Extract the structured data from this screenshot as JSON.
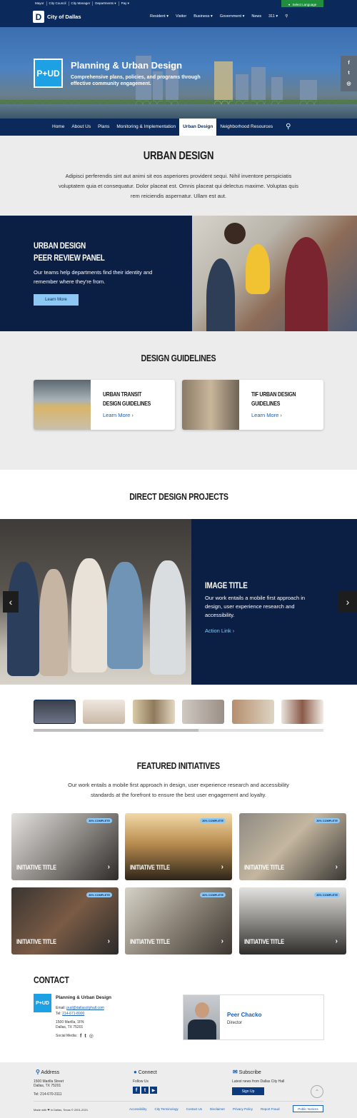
{
  "topbar": {
    "links": [
      "Mayor",
      "City Council",
      "City Manager",
      "Departments ▾",
      "Pay ▾"
    ],
    "select_language": "Select Language"
  },
  "header": {
    "logo_letter": "D",
    "logo_text": "City of Dallas",
    "nav": [
      "Resident ▾",
      "Visitor",
      "Business ▾",
      "Government ▾",
      "News",
      "311 ▾"
    ]
  },
  "hero": {
    "logo_text": "P+UD",
    "title": "Planning & Urban Design",
    "subtitle": "Comprehensive plans, policies, and programs through effective community engagement.",
    "social": [
      "f",
      "t",
      "◎"
    ]
  },
  "subnav": {
    "items": [
      "Home",
      "About Us",
      "Plans",
      "Monitoring & Implementation",
      "Urban Design",
      "Neighborhood Resources"
    ],
    "active_index": 4
  },
  "intro": {
    "title": "URBAN DESIGN",
    "text": "Adipisci perferendis sint aut animi sit eos asperiores provident sequi. Nihil inventore perspiciatis voluptatem quia et consequatur. Dolor placeat est. Omnis placeat qui delectus maxime. Voluptas quis rem reiciendis aspernatur. Ullam est aut."
  },
  "peer_review": {
    "title_line1": "URBAN DESIGN",
    "title_line2": "PEER REVIEW PANEL",
    "text": "Our teams help departments find their identity and remember where they're from.",
    "button": "Learn More"
  },
  "guidelines": {
    "title": "DESIGN GUIDELINES",
    "cards": [
      {
        "line1": "URBAN TRANSIT",
        "line2": "DESIGN GUIDELINES",
        "link": "Learn More  ›"
      },
      {
        "line1": "TIF URBAN DESIGN",
        "line2": "GUIDELINES",
        "link": "Learn More  ›"
      }
    ]
  },
  "projects": {
    "title": "DIRECT DESIGN PROJECTS",
    "slide_title": "IMAGE TITLE",
    "slide_text": "Our work entails a mobile first approach in design, user experience research and accessibility.",
    "action": "Action Link  ›",
    "prev": "‹",
    "next": "›",
    "scroll_progress": 0.57
  },
  "featured": {
    "title": "FEATURED INITIATIVES",
    "text": "Our work entails a mobile first approach in design, user experience research and accessibility standards at the forefront to ensure the best user engagement and loyalty.",
    "badge": "30% COMPLETE",
    "item_title": "INITIATIVE TITLE",
    "chevron": "›"
  },
  "contact": {
    "title": "CONTACT",
    "logo_text": "P+UD",
    "org": "Planning & Urban Design",
    "email_label": "Email:",
    "email": "pud@dallascityhall.com",
    "tel_label": "Tel:",
    "tel": "214-671-8900",
    "addr1": "1500 Marilla, 1FN",
    "addr2": "Dallas, TX 75201",
    "social_label": "Social Media:",
    "person_name": "Peer Chacko",
    "person_role": "Director"
  },
  "footer": {
    "address_heading": "Address",
    "address1": "1500 Marilla Street",
    "address2": "Dallas, TX 75201",
    "tel": "Tel: 214-670-3111",
    "connect_heading": "Connect",
    "follow": "Follow Us",
    "subscribe_heading": "Subscribe",
    "subscribe_text": "Latest news from Dallas City Hall",
    "signup": "Sign Up",
    "made": "Made with ❤ in Dallas, Texas © 2001-2021",
    "links": [
      "Accessibility",
      "City Terminology",
      "Contact Us",
      "Disclaimer",
      "Privacy Policy",
      "Report Fraud"
    ],
    "public_notices": "Public Notices",
    "to_top": "⌃"
  }
}
